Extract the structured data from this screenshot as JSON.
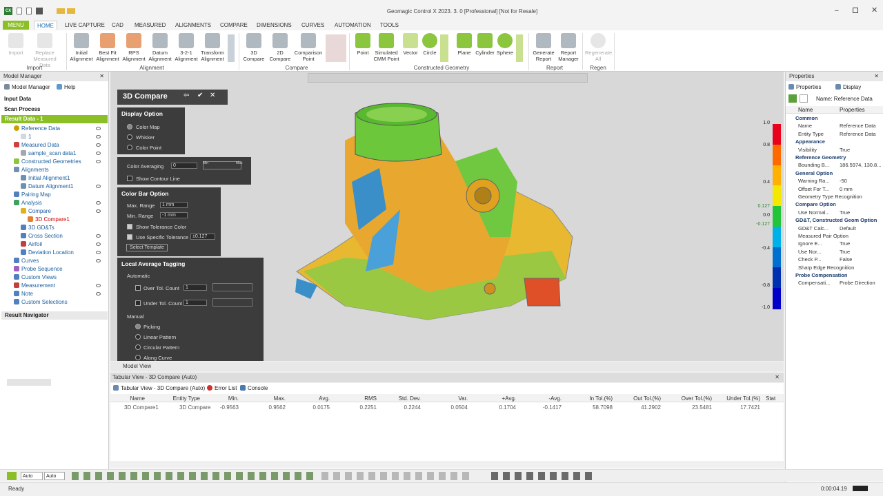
{
  "window": {
    "title": "Geomagic Control X 2023. 3. 0 [Professional] [Not for Resale]",
    "app_icon": "CX"
  },
  "tabs": [
    "MENU",
    "HOME",
    "LIVE CAPTURE",
    "CAD",
    "MEASURED",
    "ALIGNMENTS",
    "COMPARE",
    "DIMENSIONS",
    "CURVES",
    "AUTOMATION",
    "TOOLS"
  ],
  "ribbon": {
    "import": [
      "Import",
      "Replace Measured Data"
    ],
    "alignment": [
      "Initial Alignment",
      "Best Fit Alignment",
      "RPS Alignment",
      "Datum Alignment",
      "3-2-1 Alignment",
      "Transform Alignment"
    ],
    "compare": [
      "3D Compare",
      "2D Compare",
      "Comparison Point"
    ],
    "constructed": [
      "Point",
      "Simulated CMM Point",
      "Vector",
      "Circle",
      "Plane",
      "Cylinder",
      "Sphere"
    ],
    "report": [
      "Generate Report",
      "Report Manager"
    ],
    "regen": [
      "Regenerate All"
    ],
    "groups": [
      "Import",
      "Alignment",
      "Compare",
      "Constructed Geometry",
      "Report",
      "Regen"
    ]
  },
  "model_manager": {
    "title": "Model Manager",
    "tabs": [
      "Model Manager",
      "Help"
    ],
    "sections": [
      "Input Data",
      "Scan Process",
      "Result Data - 1"
    ],
    "tree": [
      "Reference Data",
      "1",
      "Measured Data",
      "sample_scan data1",
      "Constructed Geometries",
      "Alignments",
      "Initial Alignment1",
      "Datum Alignment1",
      "Pairing Map",
      "Analysis",
      "Compare",
      "3D Compare1",
      "3D GD&Ts",
      "Cross Section",
      "Airfoil",
      "Deviation Location",
      "Curves",
      "Probe Sequence",
      "Custom Views",
      "Measurement",
      "Note",
      "Custom Selections"
    ],
    "result_navigator": "Result Navigator"
  },
  "compare_panel": {
    "title": "3D Compare",
    "display_option": {
      "header": "Display Option",
      "options": [
        "Color Map",
        "Whisker",
        "Color Point"
      ],
      "selected": "Color Map"
    },
    "color_averaging": {
      "label": "Color Averaging",
      "value": "0",
      "min": "Min",
      "max": "Max"
    },
    "show_contour": "Show Contour Line",
    "color_bar": {
      "header": "Color Bar Option",
      "max_label": "Max. Range",
      "max_value": "1 mm",
      "min_label": "Min. Range",
      "min_value": "-1 mm",
      "show_tol": "Show Tolerance Color",
      "use_tol": "Use Specific Tolerance",
      "tol_value": "±0.127",
      "template": "Select Template"
    },
    "local_avg": {
      "header": "Local Average Tagging",
      "automatic": "Automatic",
      "over": "Over Tol. Count",
      "under": "Under Tol. Count",
      "count": "1",
      "manual": "Manual",
      "manual_opts": [
        "Picking",
        "Linear Pattern",
        "Circular Pattern",
        "Along Curve"
      ]
    }
  },
  "colorbar": {
    "labels": [
      "1.0",
      "0.8",
      "0.4",
      "0.127",
      "0.0",
      "-0.127",
      "-0.4",
      "-0.8",
      "-1.0"
    ],
    "colors": [
      "#e8001c",
      "#ff6a00",
      "#ffb000",
      "#f5e800",
      "#22c53a",
      "#00b0e8",
      "#0070d0",
      "#0030b0",
      "#0000c8"
    ]
  },
  "model_view_tab": "Model View",
  "tabular": {
    "header": "Tabular View - 3D Compare (Auto)",
    "tabs": [
      "Tabular View - 3D Compare (Auto)",
      "Error List",
      "Console"
    ],
    "columns": [
      "Name",
      "Entity Type",
      "Min.",
      "Max.",
      "Avg.",
      "RMS",
      "Std. Dev.",
      "Var.",
      "+Avg.",
      "-Avg.",
      "In Tol.(%)",
      "Out Tol.(%)",
      "Over Tol.(%)",
      "Under Tol.(%)",
      "Stat"
    ],
    "row": [
      "3D Compare1",
      "3D Compare",
      "-0.9563",
      "0.9562",
      "0.0175",
      "0.2251",
      "0.2244",
      "0.0504",
      "0.1704",
      "-0.1417",
      "58.7098",
      "41.2902",
      "23.5481",
      "17.7421",
      ""
    ]
  },
  "properties": {
    "title": "Properties",
    "tabs": [
      "Properties",
      "Display"
    ],
    "name_filter": "Name: Reference Data",
    "col_name": "Name",
    "col_prop": "Properties",
    "rows": [
      [
        "cat",
        "Common",
        ""
      ],
      [
        "row",
        "Name",
        "Reference Data"
      ],
      [
        "row",
        "Entity Type",
        "Reference Data"
      ],
      [
        "cat",
        "Appearance",
        ""
      ],
      [
        "row",
        "Visibility",
        "True"
      ],
      [
        "cat",
        "Reference Geometry",
        ""
      ],
      [
        "row",
        "Bounding B...",
        "186.5974, 130.8..."
      ],
      [
        "cat",
        "General Option",
        ""
      ],
      [
        "row",
        "Warning Ra...",
        "-50"
      ],
      [
        "row",
        "Offset For T...",
        "0 mm"
      ],
      [
        "row",
        "Geometry Type Recognition",
        ""
      ],
      [
        "cat",
        "Compare Option",
        ""
      ],
      [
        "row",
        "Use Normal...",
        "True"
      ],
      [
        "cat",
        "GD&T, Constructed Geom Option",
        ""
      ],
      [
        "row",
        "GD&T Calc...",
        "Default"
      ],
      [
        "row",
        "Measured Pair Option",
        ""
      ],
      [
        "row",
        "Ignore E...",
        "True"
      ],
      [
        "row",
        "Use Nor...",
        "True"
      ],
      [
        "row",
        "Check P...",
        "False"
      ],
      [
        "row",
        "Sharp Edge Recognition",
        ""
      ],
      [
        "cat",
        "Probe Compensation",
        ""
      ],
      [
        "row",
        "Compensati...",
        "Probe Direction"
      ]
    ]
  },
  "bottom": {
    "auto1": "Auto",
    "auto2": "Auto"
  },
  "status": {
    "left": "Ready",
    "time": "0:00:04.19"
  }
}
